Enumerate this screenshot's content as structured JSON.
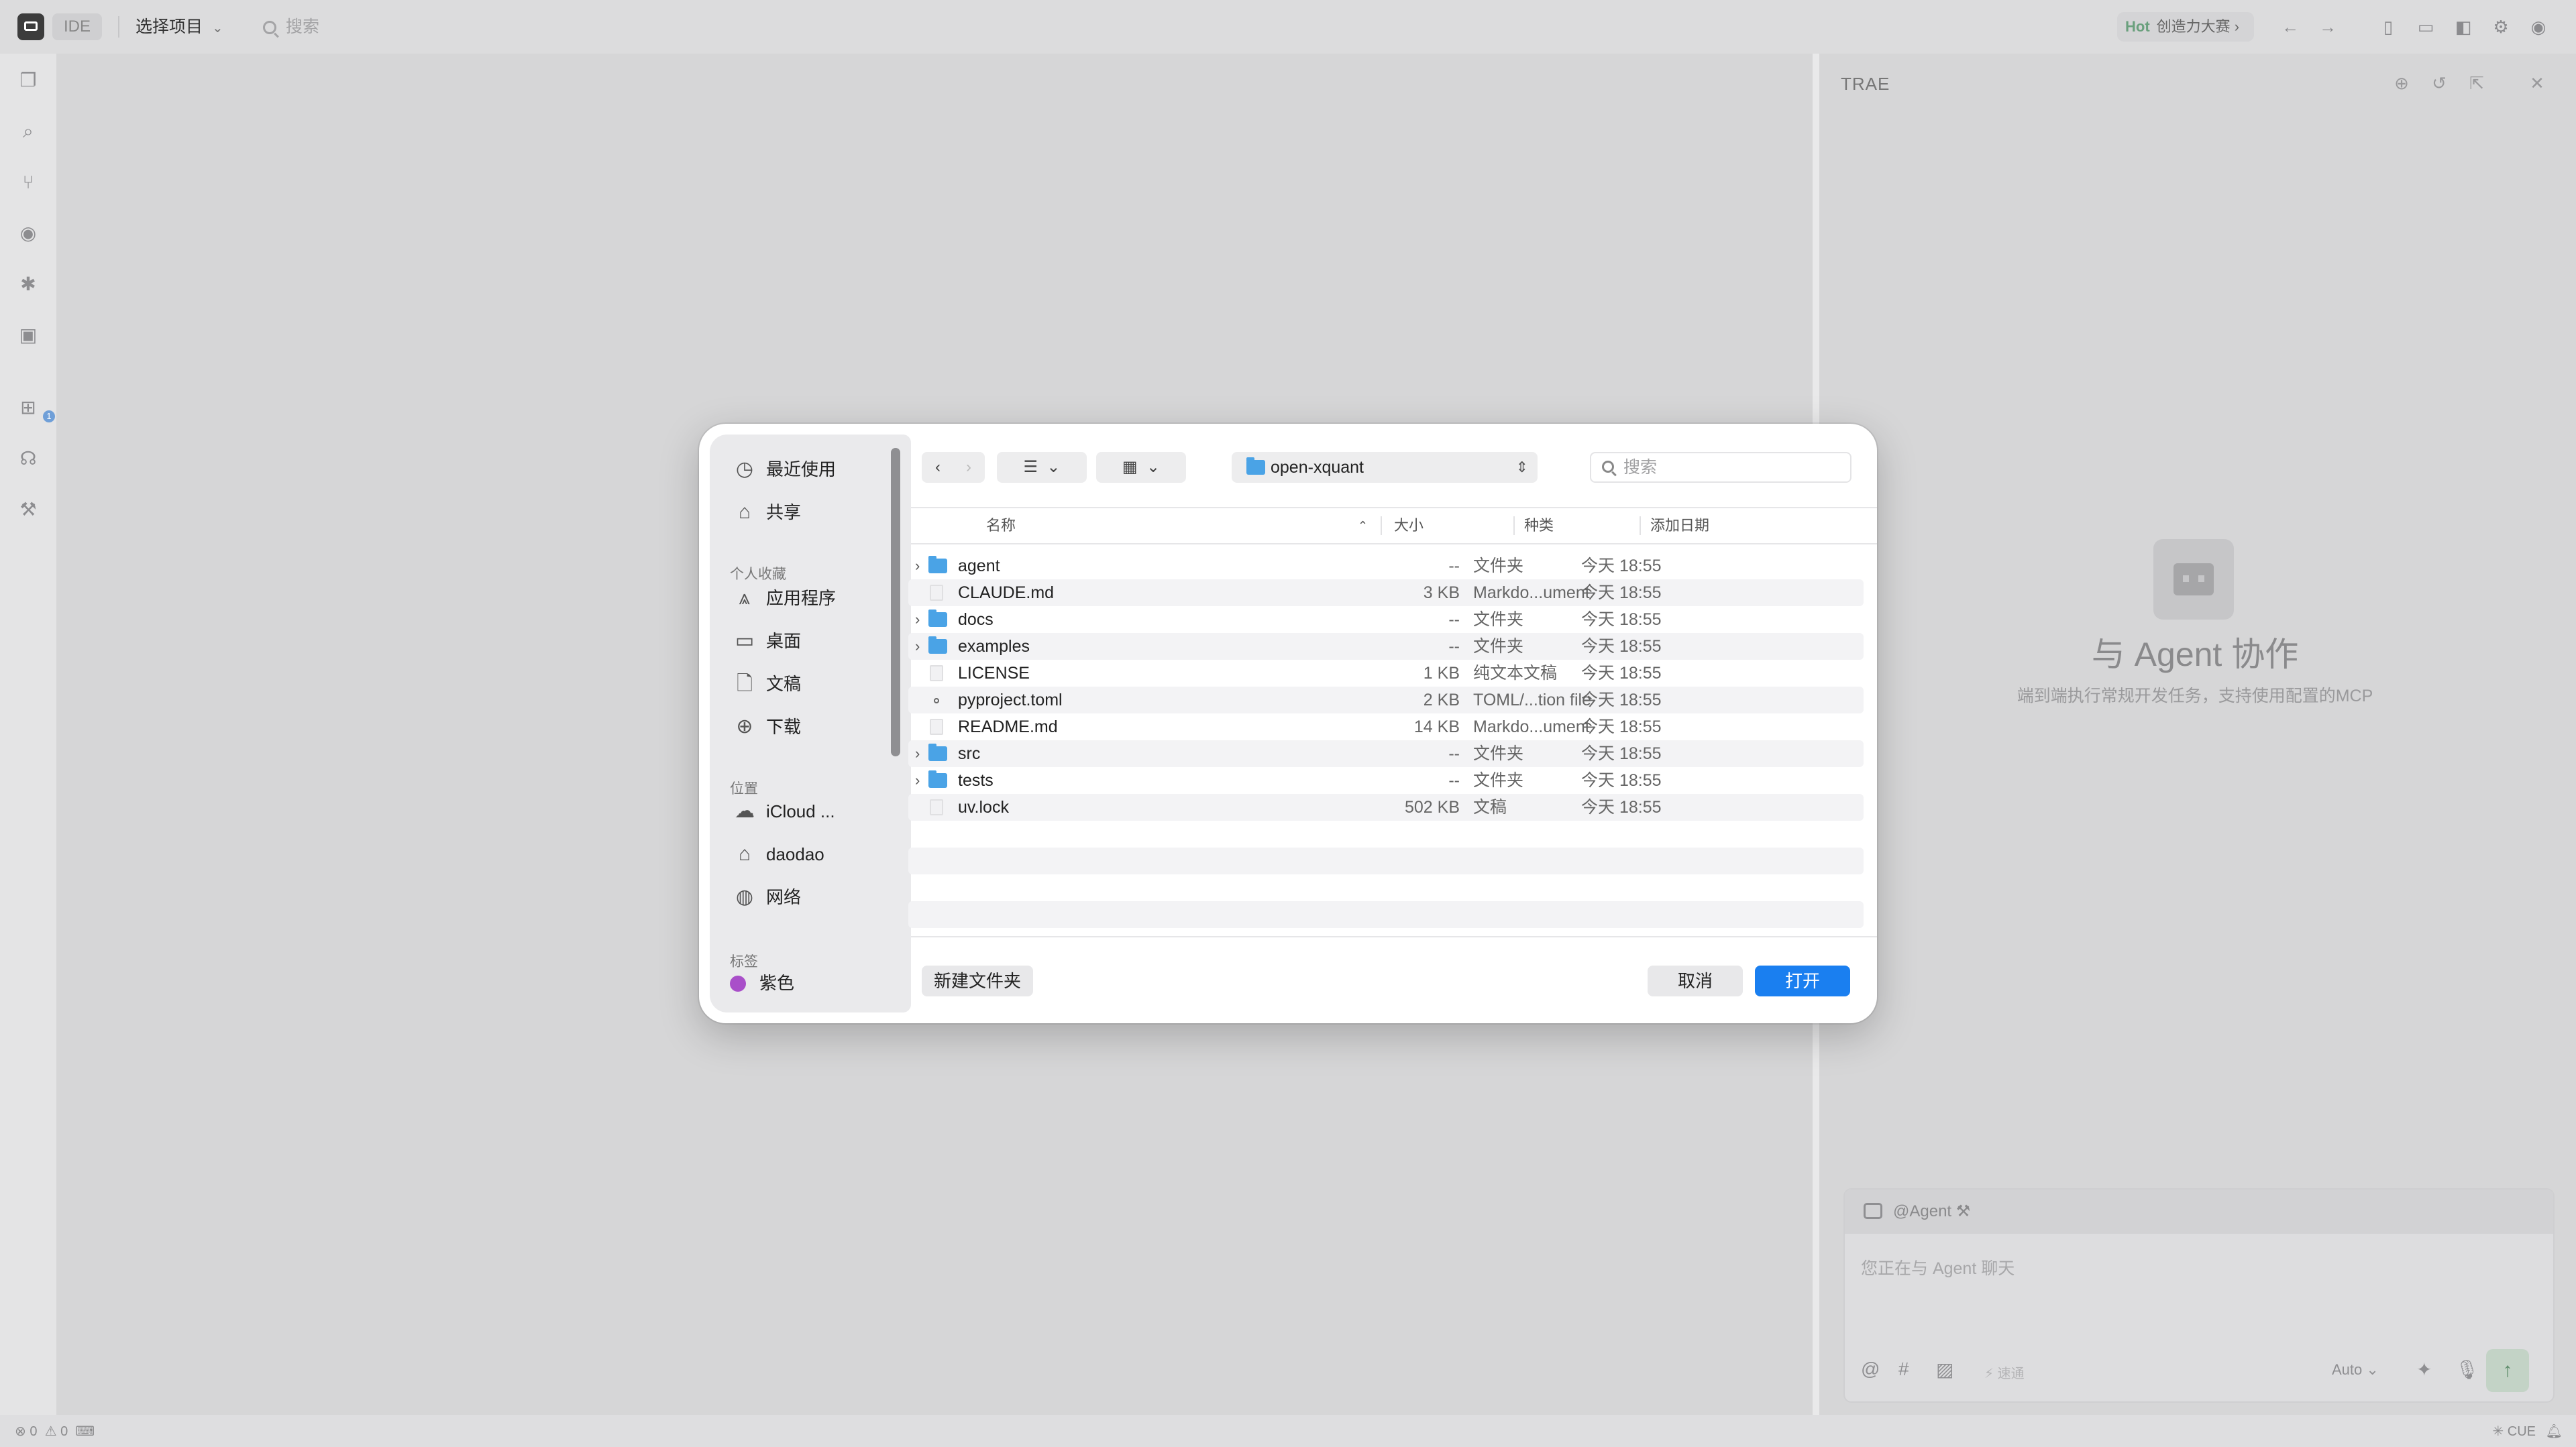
{
  "titlebar": {
    "ide_label": "IDE",
    "project_select": "选择项目",
    "search_placeholder": "搜索",
    "hot_badge": "Hot",
    "promo_text": "创造力大赛"
  },
  "panel": {
    "title": "TRAE",
    "hero_title": "与 Agent 协作",
    "hero_subtitle": "端到端执行常规开发任务，支持使用配置的MCP",
    "chat_agent_tag": "@Agent",
    "chat_placeholder": "您正在与 Agent 聊天",
    "chat_speed": "速通",
    "chat_model": "Auto"
  },
  "statusbar": {
    "errors": "0",
    "warnings": "0",
    "right_label": "CUE"
  },
  "dialog": {
    "sidebar": {
      "recent": "最近使用",
      "shared": "共享",
      "favorites_section": "个人收藏",
      "apps": "应用程序",
      "desktop": "桌面",
      "documents": "文稿",
      "downloads": "下载",
      "locations_section": "位置",
      "icloud": "iCloud ...",
      "home": "daodao",
      "network": "网络",
      "tags_section": "标签",
      "tag_purple": "紫色"
    },
    "path": "open-xquant",
    "search_placeholder": "搜索",
    "columns": {
      "name": "名称",
      "size": "大小",
      "kind": "种类",
      "date": "添加日期"
    },
    "files": [
      {
        "name": "agent",
        "size": "--",
        "kind": "文件夹",
        "date": "今天 18:55",
        "type": "folder"
      },
      {
        "name": "CLAUDE.md",
        "size": "3 KB",
        "kind": "Markdo...ument",
        "date": "今天 18:55",
        "type": "file"
      },
      {
        "name": "docs",
        "size": "--",
        "kind": "文件夹",
        "date": "今天 18:55",
        "type": "folder"
      },
      {
        "name": "examples",
        "size": "--",
        "kind": "文件夹",
        "date": "今天 18:55",
        "type": "folder"
      },
      {
        "name": "LICENSE",
        "size": "1 KB",
        "kind": "纯文本文稿",
        "date": "今天 18:55",
        "type": "file"
      },
      {
        "name": "pyproject.toml",
        "size": "2 KB",
        "kind": "TOML/...tion file",
        "date": "今天 18:55",
        "type": "toml"
      },
      {
        "name": "README.md",
        "size": "14 KB",
        "kind": "Markdo...ument",
        "date": "今天 18:55",
        "type": "file"
      },
      {
        "name": "src",
        "size": "--",
        "kind": "文件夹",
        "date": "今天 18:55",
        "type": "folder"
      },
      {
        "name": "tests",
        "size": "--",
        "kind": "文件夹",
        "date": "今天 18:55",
        "type": "folder"
      },
      {
        "name": "uv.lock",
        "size": "502 KB",
        "kind": "文稿",
        "date": "今天 18:55",
        "type": "file"
      }
    ],
    "new_folder_button": "新建文件夹",
    "cancel_button": "取消",
    "open_button": "打开"
  }
}
